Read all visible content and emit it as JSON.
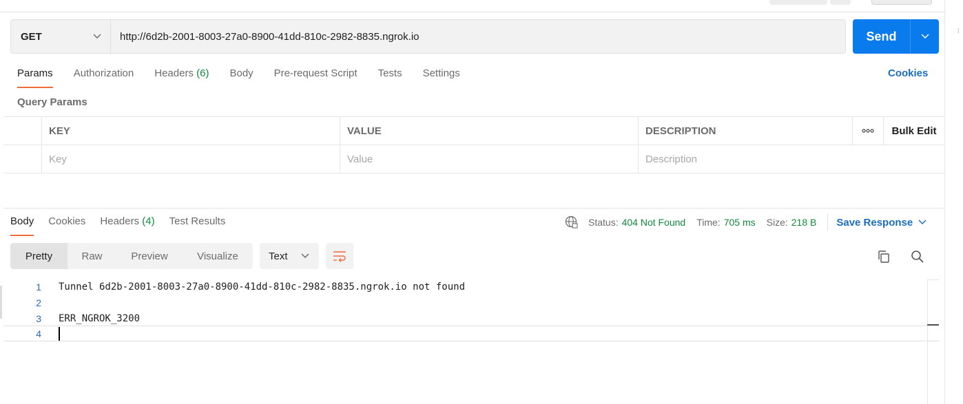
{
  "request": {
    "method": "GET",
    "url": "http://6d2b-2001-8003-27a0-8900-41dd-810c-2982-8835.ngrok.io",
    "send_label": "Send"
  },
  "request_tabs": [
    {
      "label": "Params"
    },
    {
      "label": "Authorization"
    },
    {
      "label": "Headers",
      "count": "(6)"
    },
    {
      "label": "Body"
    },
    {
      "label": "Pre-request Script"
    },
    {
      "label": "Tests"
    },
    {
      "label": "Settings"
    }
  ],
  "cookies_link": "Cookies",
  "query_params": {
    "title": "Query Params",
    "columns": {
      "key": "KEY",
      "value": "VALUE",
      "description": "DESCRIPTION",
      "bulk_edit": "Bulk Edit"
    },
    "placeholders": {
      "key": "Key",
      "value": "Value",
      "description": "Description"
    }
  },
  "response_tabs": [
    {
      "label": "Body"
    },
    {
      "label": "Cookies"
    },
    {
      "label": "Headers",
      "count": "(4)"
    },
    {
      "label": "Test Results"
    }
  ],
  "response_meta": {
    "status_label": "Status:",
    "status_value": "404 Not Found",
    "time_label": "Time:",
    "time_value": "705 ms",
    "size_label": "Size:",
    "size_value": "218 B",
    "save_response": "Save Response"
  },
  "view_modes": [
    "Pretty",
    "Raw",
    "Preview",
    "Visualize"
  ],
  "format": "Text",
  "response_body": [
    {
      "n": "1",
      "text": "Tunnel 6d2b-2001-8003-27a0-8900-41dd-810c-2982-8835.ngrok.io not found"
    },
    {
      "n": "2",
      "text": ""
    },
    {
      "n": "3",
      "text": "ERR_NGROK_3200"
    },
    {
      "n": "4",
      "text": ""
    }
  ],
  "colors": {
    "accent": "#097bed",
    "tab_underline": "#f26b3a",
    "success": "#0f8a3c",
    "link": "#1a6ebf"
  }
}
